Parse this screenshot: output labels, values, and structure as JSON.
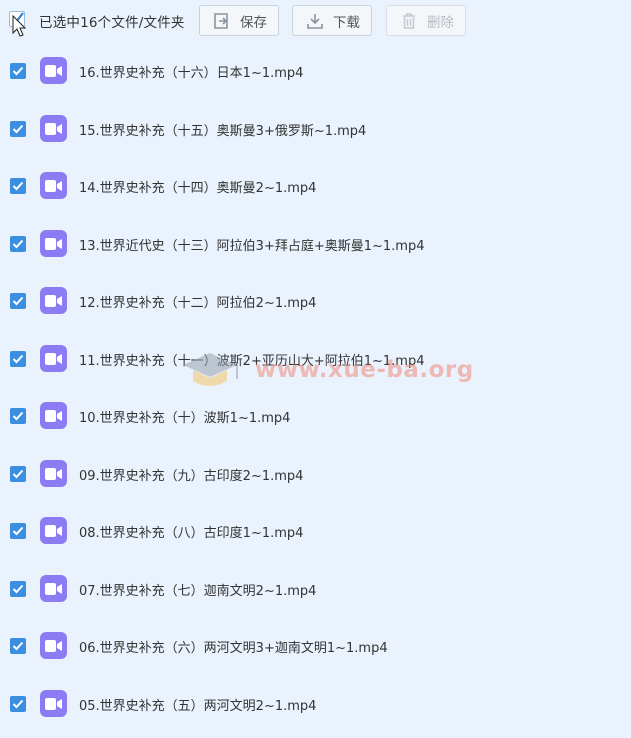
{
  "toolbar": {
    "selection_text": "已选中16个文件/文件夹",
    "save_label": "保存",
    "download_label": "下载",
    "delete_label": "删除"
  },
  "files": [
    {
      "name": "16.世界史补充（十六）日本1~1.mp4"
    },
    {
      "name": "15.世界史补充（十五）奥斯曼3+俄罗斯~1.mp4"
    },
    {
      "name": "14.世界史补充（十四）奥斯曼2~1.mp4"
    },
    {
      "name": "13.世界近代史（十三）阿拉伯3+拜占庭+奥斯曼1~1.mp4"
    },
    {
      "name": "12.世界史补充（十二）阿拉伯2~1.mp4"
    },
    {
      "name": "11.世界史补充（十一）波斯2+亚历山大+阿拉伯1~1.mp4"
    },
    {
      "name": "10.世界史补充（十）波斯1~1.mp4"
    },
    {
      "name": "09.世界史补充（九）古印度2~1.mp4"
    },
    {
      "name": "08.世界史补充（八）古印度1~1.mp4"
    },
    {
      "name": "07.世界史补充（七）迦南文明2~1.mp4"
    },
    {
      "name": "06.世界史补充（六）两河文明3+迦南文明1~1.mp4"
    },
    {
      "name": "05.世界史补充（五）两河文明2~1.mp4"
    }
  ],
  "watermark": {
    "text": "www.xue-ba.org"
  },
  "colors": {
    "background": "#eaf3fd",
    "checkbox": "#3b8fe0",
    "video_icon": "#8c7cf3",
    "watermark": "#f08a7a"
  },
  "icons": {
    "file_type": "video-icon",
    "save": "save-icon",
    "download": "download-icon",
    "delete": "trash-icon"
  }
}
